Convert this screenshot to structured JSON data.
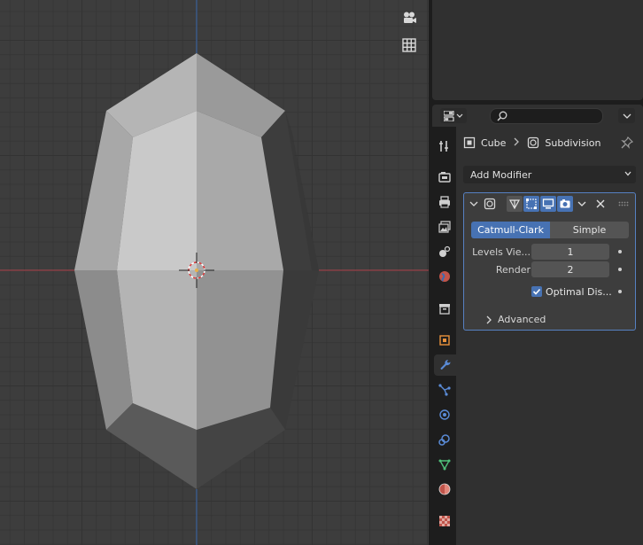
{
  "viewport": {
    "grid_color": "#3d3d3d",
    "x_axis_color": "#b3464f",
    "y_axis_color": "#3d6bb0",
    "object": "subdivided cube, front orthographic view",
    "buttons": [
      {
        "name": "camera-view-icon"
      },
      {
        "name": "ortho-grid-icon"
      }
    ]
  },
  "properties_header": {
    "editor_type_icon": "properties-editor-icon",
    "search_placeholder": ""
  },
  "tabs": [
    {
      "name": "tab-tool",
      "icon": "tool-icon"
    },
    {
      "name": "tab-render",
      "icon": "render-icon"
    },
    {
      "name": "tab-output",
      "icon": "printer-icon"
    },
    {
      "name": "tab-view-layer",
      "icon": "image-stack-icon"
    },
    {
      "name": "tab-scene",
      "icon": "scene-icon"
    },
    {
      "name": "tab-world",
      "icon": "world-icon"
    },
    {
      "name": "tab-collection",
      "icon": "collection-icon"
    },
    {
      "name": "tab-object",
      "icon": "object-icon"
    },
    {
      "name": "tab-modifiers",
      "icon": "wrench-icon",
      "active": true
    },
    {
      "name": "tab-particles",
      "icon": "particles-icon"
    },
    {
      "name": "tab-physics",
      "icon": "physics-icon"
    },
    {
      "name": "tab-constraints",
      "icon": "constraint-icon"
    },
    {
      "name": "tab-data",
      "icon": "mesh-data-icon"
    },
    {
      "name": "tab-material",
      "icon": "material-icon"
    },
    {
      "name": "tab-texture",
      "icon": "texture-icon"
    }
  ],
  "breadcrumb": {
    "object": "Cube",
    "modifier": "Subdivision"
  },
  "add_modifier_label": "Add Modifier",
  "modifier": {
    "type_options": [
      "Catmull-Clark",
      "Simple"
    ],
    "selected_type": "Catmull-Clark",
    "levels_viewport_label": "Levels Vie...",
    "levels_viewport_value": "1",
    "render_label": "Render",
    "render_value": "2",
    "optimal_display_label": "Optimal Dis...",
    "optimal_display_checked": true,
    "advanced_label": "Advanced"
  },
  "colors": {
    "accent": "#4772b3",
    "panel_border": "#5680c2"
  }
}
